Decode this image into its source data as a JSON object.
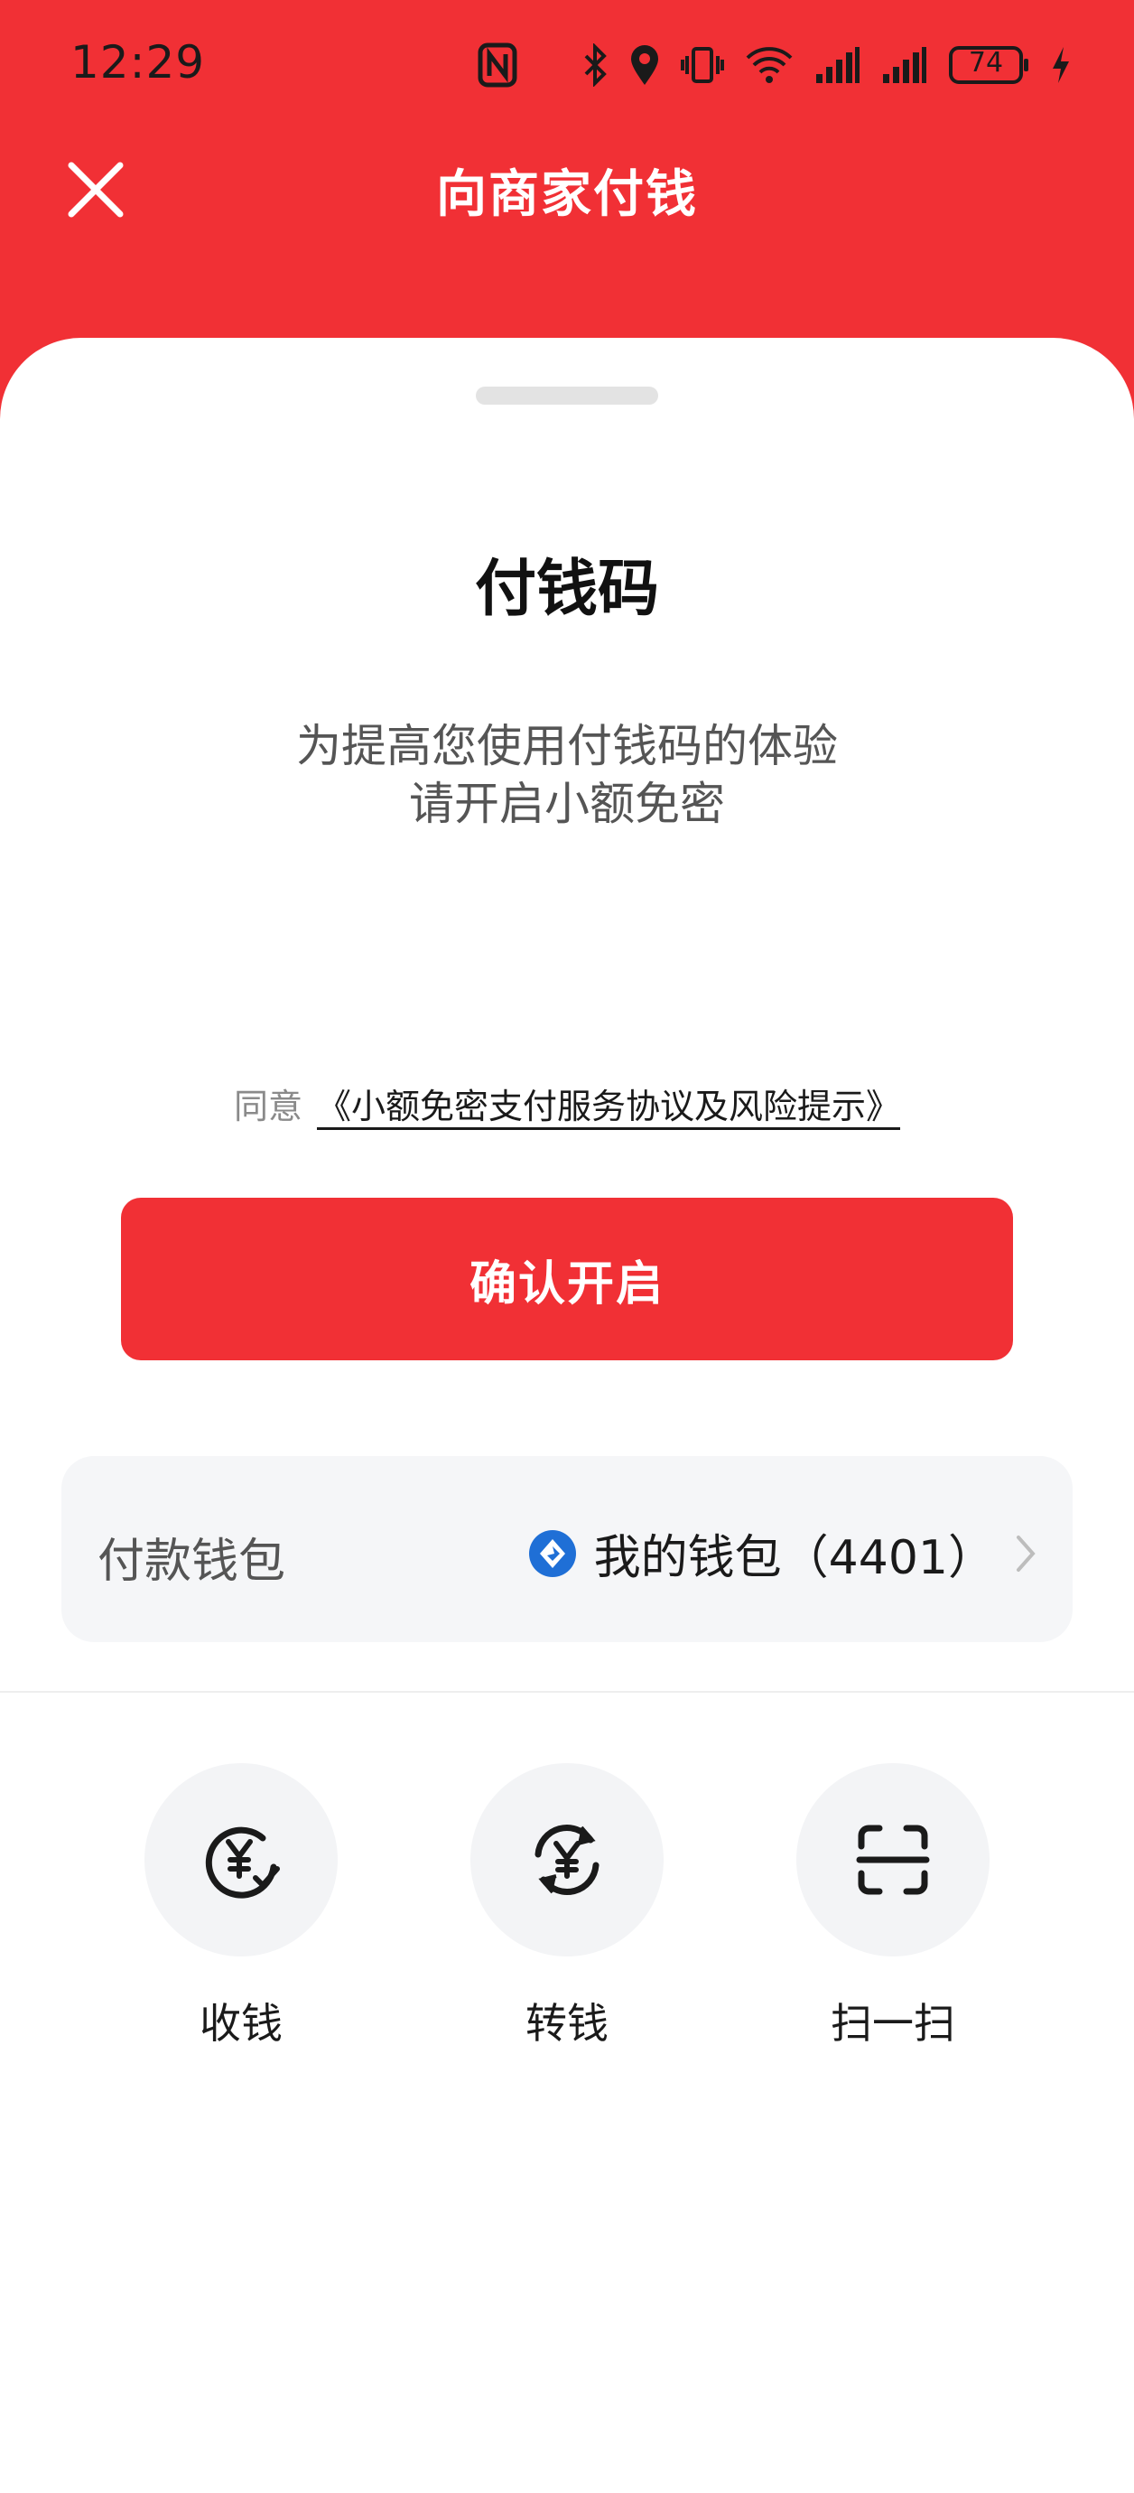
{
  "status_bar": {
    "time": "12:29",
    "battery": "74"
  },
  "header": {
    "title": "向商家付钱"
  },
  "sheet": {
    "title": "付钱码",
    "desc_line1": "为提高您使用付钱码的体验",
    "desc_line2": "请开启小额免密",
    "agree_prefix": "同意",
    "agree_link": "《小额免密支付服务协议及风险提示》",
    "confirm_label": "确认开启"
  },
  "wallet": {
    "label": "付款钱包",
    "value": "我的钱包（4401）"
  },
  "actions": [
    {
      "label": "收钱",
      "icon": "receive-money-icon"
    },
    {
      "label": "转钱",
      "icon": "transfer-money-icon"
    },
    {
      "label": "扫一扫",
      "icon": "scan-icon"
    }
  ],
  "colors": {
    "brand_red": "#f13035",
    "bank_blue": "#1f6fd6"
  }
}
